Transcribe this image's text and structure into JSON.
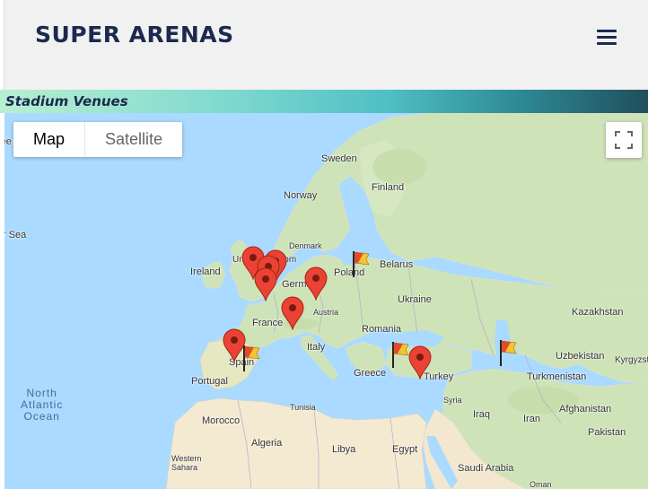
{
  "header": {
    "logo": "SUPER ARENAS",
    "menu_icon": "hamburger-menu-icon"
  },
  "section": {
    "title": "Stadium Venues"
  },
  "map": {
    "map_type": {
      "map": "Map",
      "satellite": "Satellite",
      "selected": "Map"
    },
    "fullscreen_icon": "fullscreen-icon",
    "labels": {
      "sweden": "Sweden",
      "finland": "Finland",
      "norway": "Norway",
      "denmark": "Denmark",
      "ireland": "Ireland",
      "united_kingdom": "United Kingdom",
      "germany": "Germany",
      "poland": "Poland",
      "belarus": "Belarus",
      "ukraine": "Ukraine",
      "kazakhstan": "Kazakhstan",
      "france": "France",
      "austria": "Austria",
      "romania": "Romania",
      "italy": "Italy",
      "spain": "Spain",
      "portugal": "Portugal",
      "greece": "Greece",
      "turkey": "Turkey",
      "uzbekistan": "Uzbekistan",
      "kyrgyzstan": "Kyrgyzsta",
      "turkmenistan": "Turkmenistan",
      "syria": "Syria",
      "iraq": "Iraq",
      "iran": "Iran",
      "afghanistan": "Afghanistan",
      "tunisia": "Tunisia",
      "morocco": "Morocco",
      "algeria": "Algeria",
      "libya": "Libya",
      "egypt": "Egypt",
      "saudi_arabia": "Saudi Arabia",
      "pakistan": "Pakistan",
      "oman": "Oman",
      "western_sahara": "Western\nSahara",
      "north_sea_fragment": "r Sea",
      "ice_fragment": "ree",
      "north_atlantic_ocean": "North\nAtlantic\nOcean"
    }
  }
}
